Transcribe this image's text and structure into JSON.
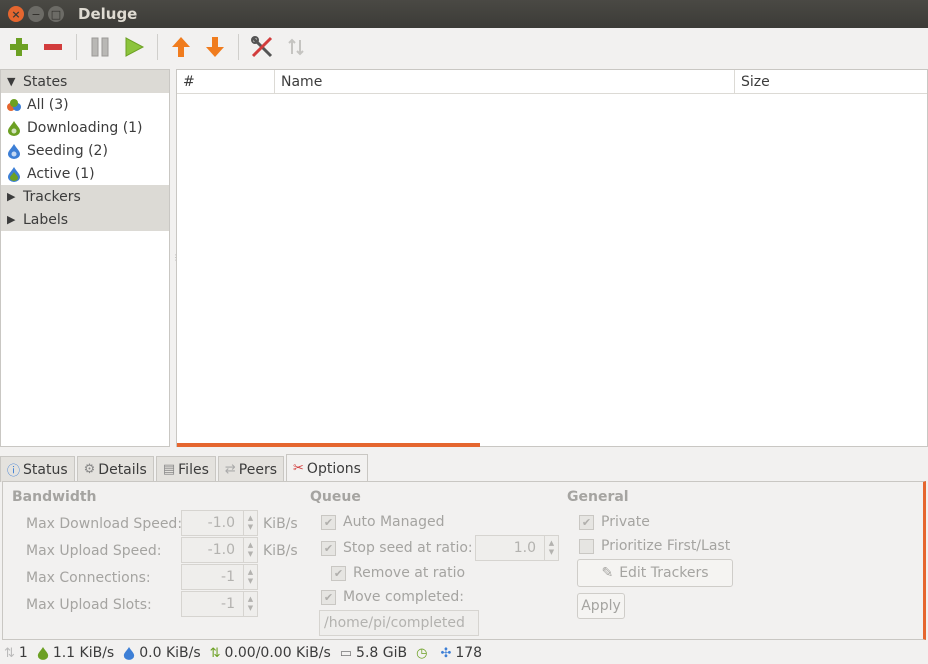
{
  "window": {
    "title": "Deluge"
  },
  "sidebar": {
    "groups": [
      {
        "label": "States",
        "expanded": true
      },
      {
        "label": "Trackers",
        "expanded": false
      },
      {
        "label": "Labels",
        "expanded": false
      }
    ],
    "states": [
      {
        "label": "All (3)",
        "icon": "all-states-icon"
      },
      {
        "label": "Downloading (1)",
        "icon": "downloading-icon"
      },
      {
        "label": "Seeding (2)",
        "icon": "seeding-icon"
      },
      {
        "label": "Active (1)",
        "icon": "active-icon"
      }
    ]
  },
  "torrent_list": {
    "columns": [
      "#",
      "Name",
      "Size"
    ]
  },
  "tabs": [
    {
      "label": "Status",
      "icon": "info-icon"
    },
    {
      "label": "Details",
      "icon": "gear-icon"
    },
    {
      "label": "Files",
      "icon": "files-icon"
    },
    {
      "label": "Peers",
      "icon": "peers-icon"
    },
    {
      "label": "Options",
      "icon": "options-icon",
      "active": true
    }
  ],
  "options": {
    "bandwidth": {
      "title": "Bandwidth",
      "max_download_label": "Max Download Speed:",
      "max_download_value": "-1.0",
      "max_upload_label": "Max Upload Speed:",
      "max_upload_value": "-1.0",
      "max_connections_label": "Max Connections:",
      "max_connections_value": "-1",
      "max_upload_slots_label": "Max Upload Slots:",
      "max_upload_slots_value": "-1",
      "unit": "KiB/s"
    },
    "queue": {
      "title": "Queue",
      "auto_managed_label": "Auto Managed",
      "stop_seed_label": "Stop seed at ratio:",
      "stop_seed_value": "1.0",
      "remove_at_ratio_label": "Remove at ratio",
      "move_completed_label": "Move completed:",
      "move_completed_path": "/home/pi/completed"
    },
    "general": {
      "title": "General",
      "private_label": "Private",
      "prioritize_label": "Prioritize First/Last",
      "edit_trackers_label": "Edit Trackers",
      "apply_label": "Apply"
    }
  },
  "statusbar": {
    "connections": "1",
    "download_speed": "1.1 KiB/s",
    "upload_speed": "0.0 KiB/s",
    "protocol_traffic": "0.00/0.00 KiB/s",
    "free_space": "5.8 GiB",
    "dht_nodes": "178"
  },
  "colors": {
    "accent": "#e5662f",
    "titlebar": "#3c3b37"
  }
}
